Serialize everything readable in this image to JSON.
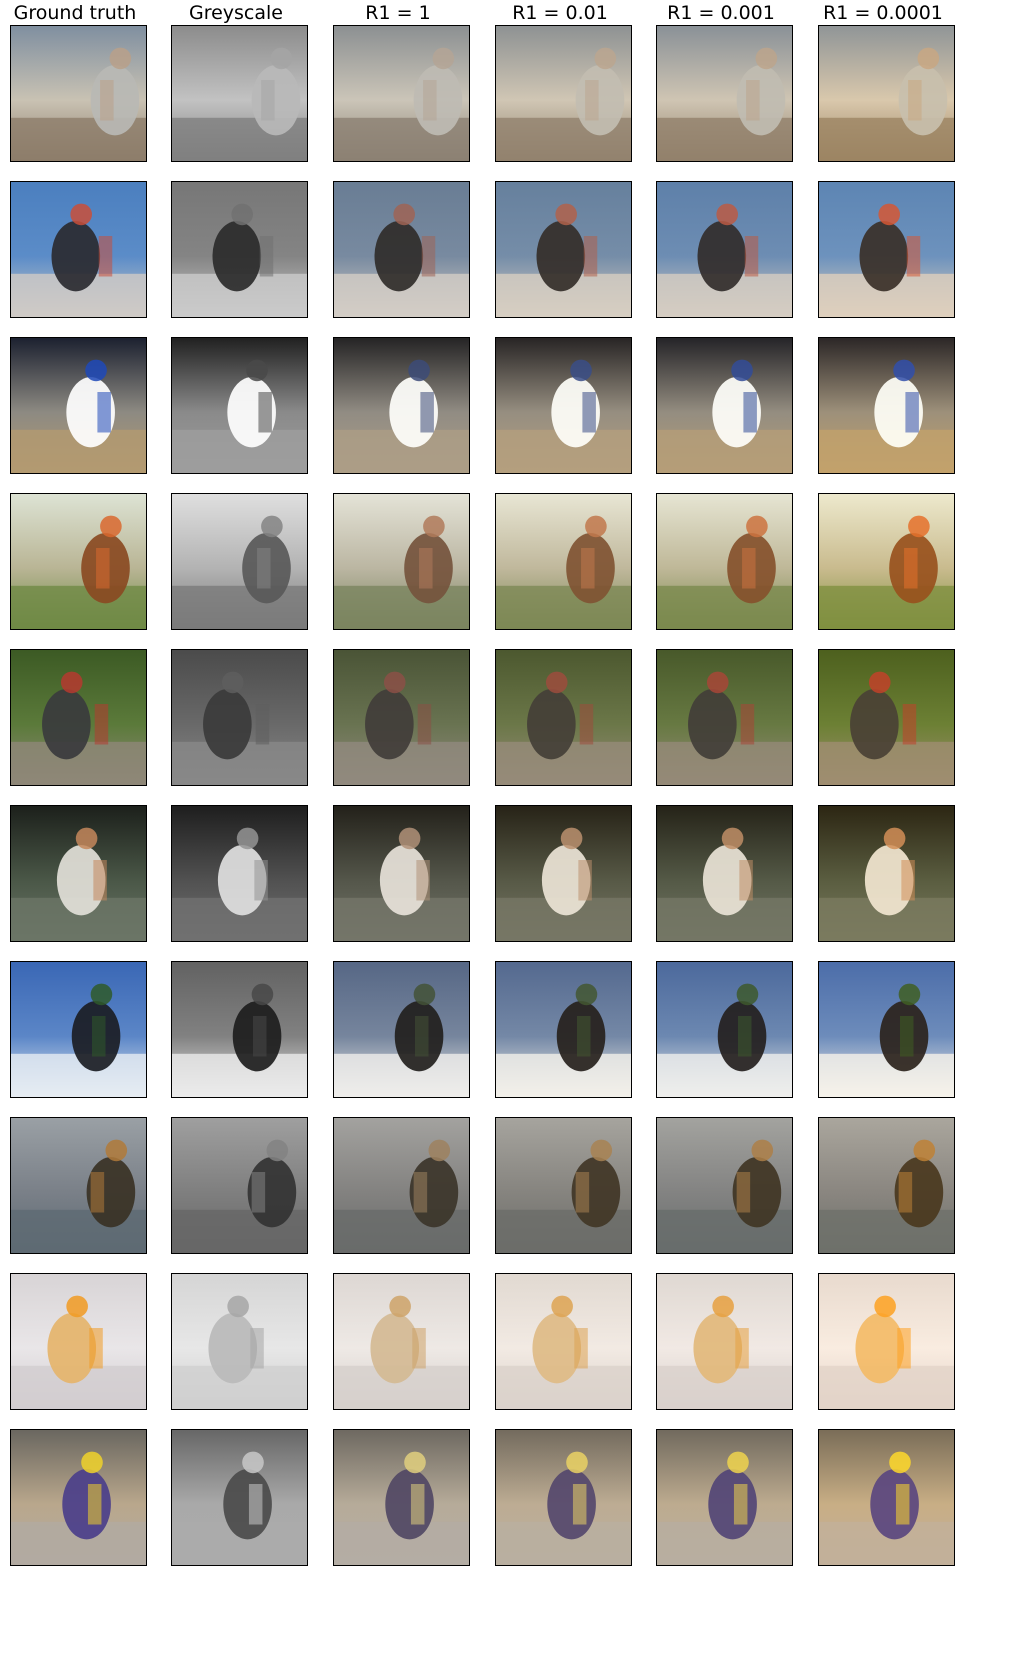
{
  "figure": {
    "columns": [
      {
        "label": "Ground truth",
        "mode": "gt"
      },
      {
        "label": "Greyscale",
        "mode": "grey"
      },
      {
        "label": "R1 = 1",
        "mode": "r1_1"
      },
      {
        "label": "R1 = 0.01",
        "mode": "r1_01"
      },
      {
        "label": "R1 = 0.001",
        "mode": "r1_001"
      },
      {
        "label": "R1 = 0.0001",
        "mode": "r1_0001"
      }
    ],
    "rows": [
      {
        "scene": "person-selfie",
        "colors": {
          "bg": "#c9c2b3",
          "top": "#7f8fa0",
          "subject": "#b8b9b4",
          "accent": "#b9a089",
          "ground": "#8d7d6a"
        }
      },
      {
        "scene": "beach-kite",
        "colors": {
          "bg": "#5b8cc8",
          "top": "#4b7fbf",
          "subject": "#2a2a30",
          "accent": "#c94f3a",
          "ground": "#cfcac5"
        }
      },
      {
        "scene": "tennis",
        "colors": {
          "bg": "#8d8a82",
          "top": "#1c2130",
          "subject": "#ffffff",
          "accent": "#1f49b8",
          "ground": "#b39a71"
        }
      },
      {
        "scene": "horse-jump",
        "colors": {
          "bg": "#b9b595",
          "top": "#dde3d4",
          "subject": "#8a4a22",
          "accent": "#d9692f",
          "ground": "#6f8a45"
        }
      },
      {
        "scene": "truck-forest",
        "colors": {
          "bg": "#5b7a3a",
          "top": "#3c5a24",
          "subject": "#3a3b3d",
          "accent": "#b53a2f",
          "ground": "#8f8778"
        }
      },
      {
        "scene": "surfer-rock",
        "colors": {
          "bg": "#4a5747",
          "top": "#1c201b",
          "subject": "#e2e0d8",
          "accent": "#c4875c",
          "ground": "#6b7566"
        }
      },
      {
        "scene": "snow-person",
        "colors": {
          "bg": "#5b86c7",
          "top": "#3a67b5",
          "subject": "#1b1d24",
          "accent": "#2f5a2a",
          "ground": "#e6ecf2"
        }
      },
      {
        "scene": "surfer-dog",
        "colors": {
          "bg": "#7a8088",
          "top": "#9aa0a5",
          "subject": "#3a3225",
          "accent": "#b07a3a",
          "ground": "#5e6a73"
        }
      },
      {
        "scene": "drink-lemon",
        "colors": {
          "bg": "#e9e6e8",
          "top": "#d8d4d6",
          "subject": "#e5b46b",
          "accent": "#f19a22",
          "ground": "#d2cdd0"
        }
      },
      {
        "scene": "train",
        "colors": {
          "bg": "#b9a78c",
          "top": "#6a6760",
          "subject": "#4b3f8a",
          "accent": "#f0d22a",
          "ground": "#b2aaa1"
        }
      }
    ]
  }
}
